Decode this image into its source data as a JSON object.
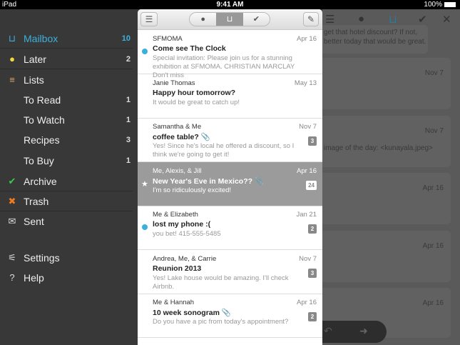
{
  "status": {
    "device": "iPad",
    "time": "9:41 AM",
    "battery": "100%"
  },
  "sidebar": {
    "items": [
      {
        "label": "Mailbox",
        "count": "10",
        "icon": "mailbox-icon",
        "glyph": "⊔",
        "color": "#3cb0dc"
      },
      {
        "label": "Later",
        "count": "2",
        "icon": "clock-icon",
        "glyph": "●",
        "color": "#f5d93a"
      },
      {
        "label": "Lists",
        "count": "",
        "icon": "lists-icon",
        "glyph": "≡",
        "color": "#d9a766"
      },
      {
        "label": "To Read",
        "count": "1",
        "icon": "",
        "glyph": "",
        "color": ""
      },
      {
        "label": "To Watch",
        "count": "1",
        "icon": "",
        "glyph": "",
        "color": ""
      },
      {
        "label": "Recipes",
        "count": "3",
        "icon": "",
        "glyph": "",
        "color": ""
      },
      {
        "label": "To Buy",
        "count": "1",
        "icon": "",
        "glyph": "",
        "color": ""
      },
      {
        "label": "Archive",
        "count": "",
        "icon": "check-icon",
        "glyph": "✔",
        "color": "#3ccc4a"
      },
      {
        "label": "Trash",
        "count": "",
        "icon": "x-icon",
        "glyph": "✖",
        "color": "#f07a1e"
      },
      {
        "label": "Sent",
        "count": "",
        "icon": "envelope-icon",
        "glyph": "✉",
        "color": "#ddd"
      },
      {
        "label": "Settings",
        "count": "",
        "icon": "sliders-icon",
        "glyph": "⚟",
        "color": "#ddd"
      },
      {
        "label": "Help",
        "count": "",
        "icon": "help-icon",
        "glyph": "?",
        "color": "#ddd"
      }
    ]
  },
  "list": {
    "rows": [
      {
        "from": "SFMOMA",
        "date": "Apr 16",
        "subject": "Come see The Clock",
        "preview": "Special invitation: Please join us for a stunning exhibition at SFMOMA. CHRISTIAN MARCLAY Don't miss",
        "unread": true,
        "attach": false,
        "count": ""
      },
      {
        "from": "Janie Thomas",
        "date": "May 13",
        "subject": "Happy hour tomorrow?",
        "preview": "It would be great to catch up!",
        "unread": false,
        "attach": false,
        "count": ""
      },
      {
        "from": "Samantha & Me",
        "date": "Nov 7",
        "subject": "coffee table?",
        "preview": "Yes! Since he's local he offered a discount, so I think we're going to get it!",
        "unread": false,
        "attach": true,
        "count": "3"
      },
      {
        "from": "Me, Alexis, & Jill",
        "date": "Apr 16",
        "subject": "New Year's Eve in Mexico??",
        "preview": "I'm so ridiculously excited!",
        "unread": false,
        "attach": true,
        "count": "24",
        "selected": true
      },
      {
        "from": "Me & Elizabeth",
        "date": "Jan 21",
        "subject": "lost my phone :(",
        "preview": "you bet! 415-555-5485",
        "unread": true,
        "attach": false,
        "count": "2"
      },
      {
        "from": "Andrea, Me, & Carrie",
        "date": "Nov 7",
        "subject": "Reunion 2013",
        "preview": "Yes! Lake house would be amazing. I'll check Airbnb.",
        "unread": false,
        "attach": false,
        "count": "3"
      },
      {
        "from": "Me & Hannah",
        "date": "Apr 16",
        "subject": "10 week sonogram",
        "preview": "Do you have a pic from today's appointment?",
        "unread": false,
        "attach": true,
        "count": "2"
      }
    ]
  },
  "detail": {
    "top_text": "get that hotel discount? If not, better today that would be great.",
    "cards": [
      {
        "date": "Nov 7",
        "text": ""
      },
      {
        "date": "Nov 7",
        "text": "image of the day: <kunayala.jpeg>"
      },
      {
        "date": "Apr 16",
        "text": ""
      },
      {
        "date": "Apr 16",
        "text": ""
      },
      {
        "date": "Apr 16",
        "text": ""
      }
    ]
  }
}
